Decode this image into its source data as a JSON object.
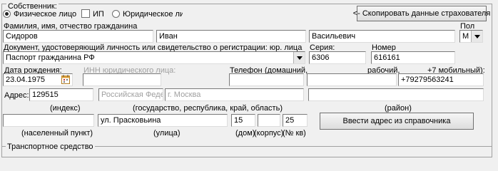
{
  "owner": {
    "title": "Собственник:",
    "type_options": {
      "person": "Физическое лицо",
      "ip": "ИП",
      "legal": "Юридическое лицо"
    },
    "copy_button": "<- Скопировать данные страхователя"
  },
  "name": {
    "label": "Фамилия, имя, отчество гражданина",
    "last": "Сидоров",
    "first": "Иван",
    "middle": "Васильевич",
    "gender_label": "Пол",
    "gender_value": "М"
  },
  "document": {
    "label": "Документ, удостоверяющий личность или свидетельство о регистрации: юр. лица",
    "type": "Паспорт гражданина РФ",
    "series_label": "Серия:",
    "series": "6306",
    "number_label": "Номер",
    "number": "616161"
  },
  "dob": {
    "label": "Дата рождения:",
    "value": "23.04.1975"
  },
  "inn": {
    "label": "ИНН юридического лица:"
  },
  "phone": {
    "label": "Телефон",
    "home_label": "(домашний,",
    "work_label": "рабочий,",
    "mobile_label": "+7   мобильный):",
    "mobile_value": "+79279563241"
  },
  "address": {
    "label": "Адрес:",
    "index": "129515",
    "country_placeholder": "Российская Федер",
    "region_placeholder": "г. Москва",
    "index_hint": "(индекс)",
    "region_hint": "(государство, республика, край, область)",
    "district_hint": "(район)",
    "street": "ул. Прасковьина",
    "house": "15",
    "flat": "25",
    "locality_hint": "(населенный пункт)",
    "street_hint": "(улица)",
    "house_hint": "(дом)",
    "korpus_hint": "(корпус)",
    "flat_hint": "(№ кв)",
    "lookup_button": "Ввести адрес из справочника"
  },
  "vehicle": {
    "title": "Транспортное средство"
  }
}
